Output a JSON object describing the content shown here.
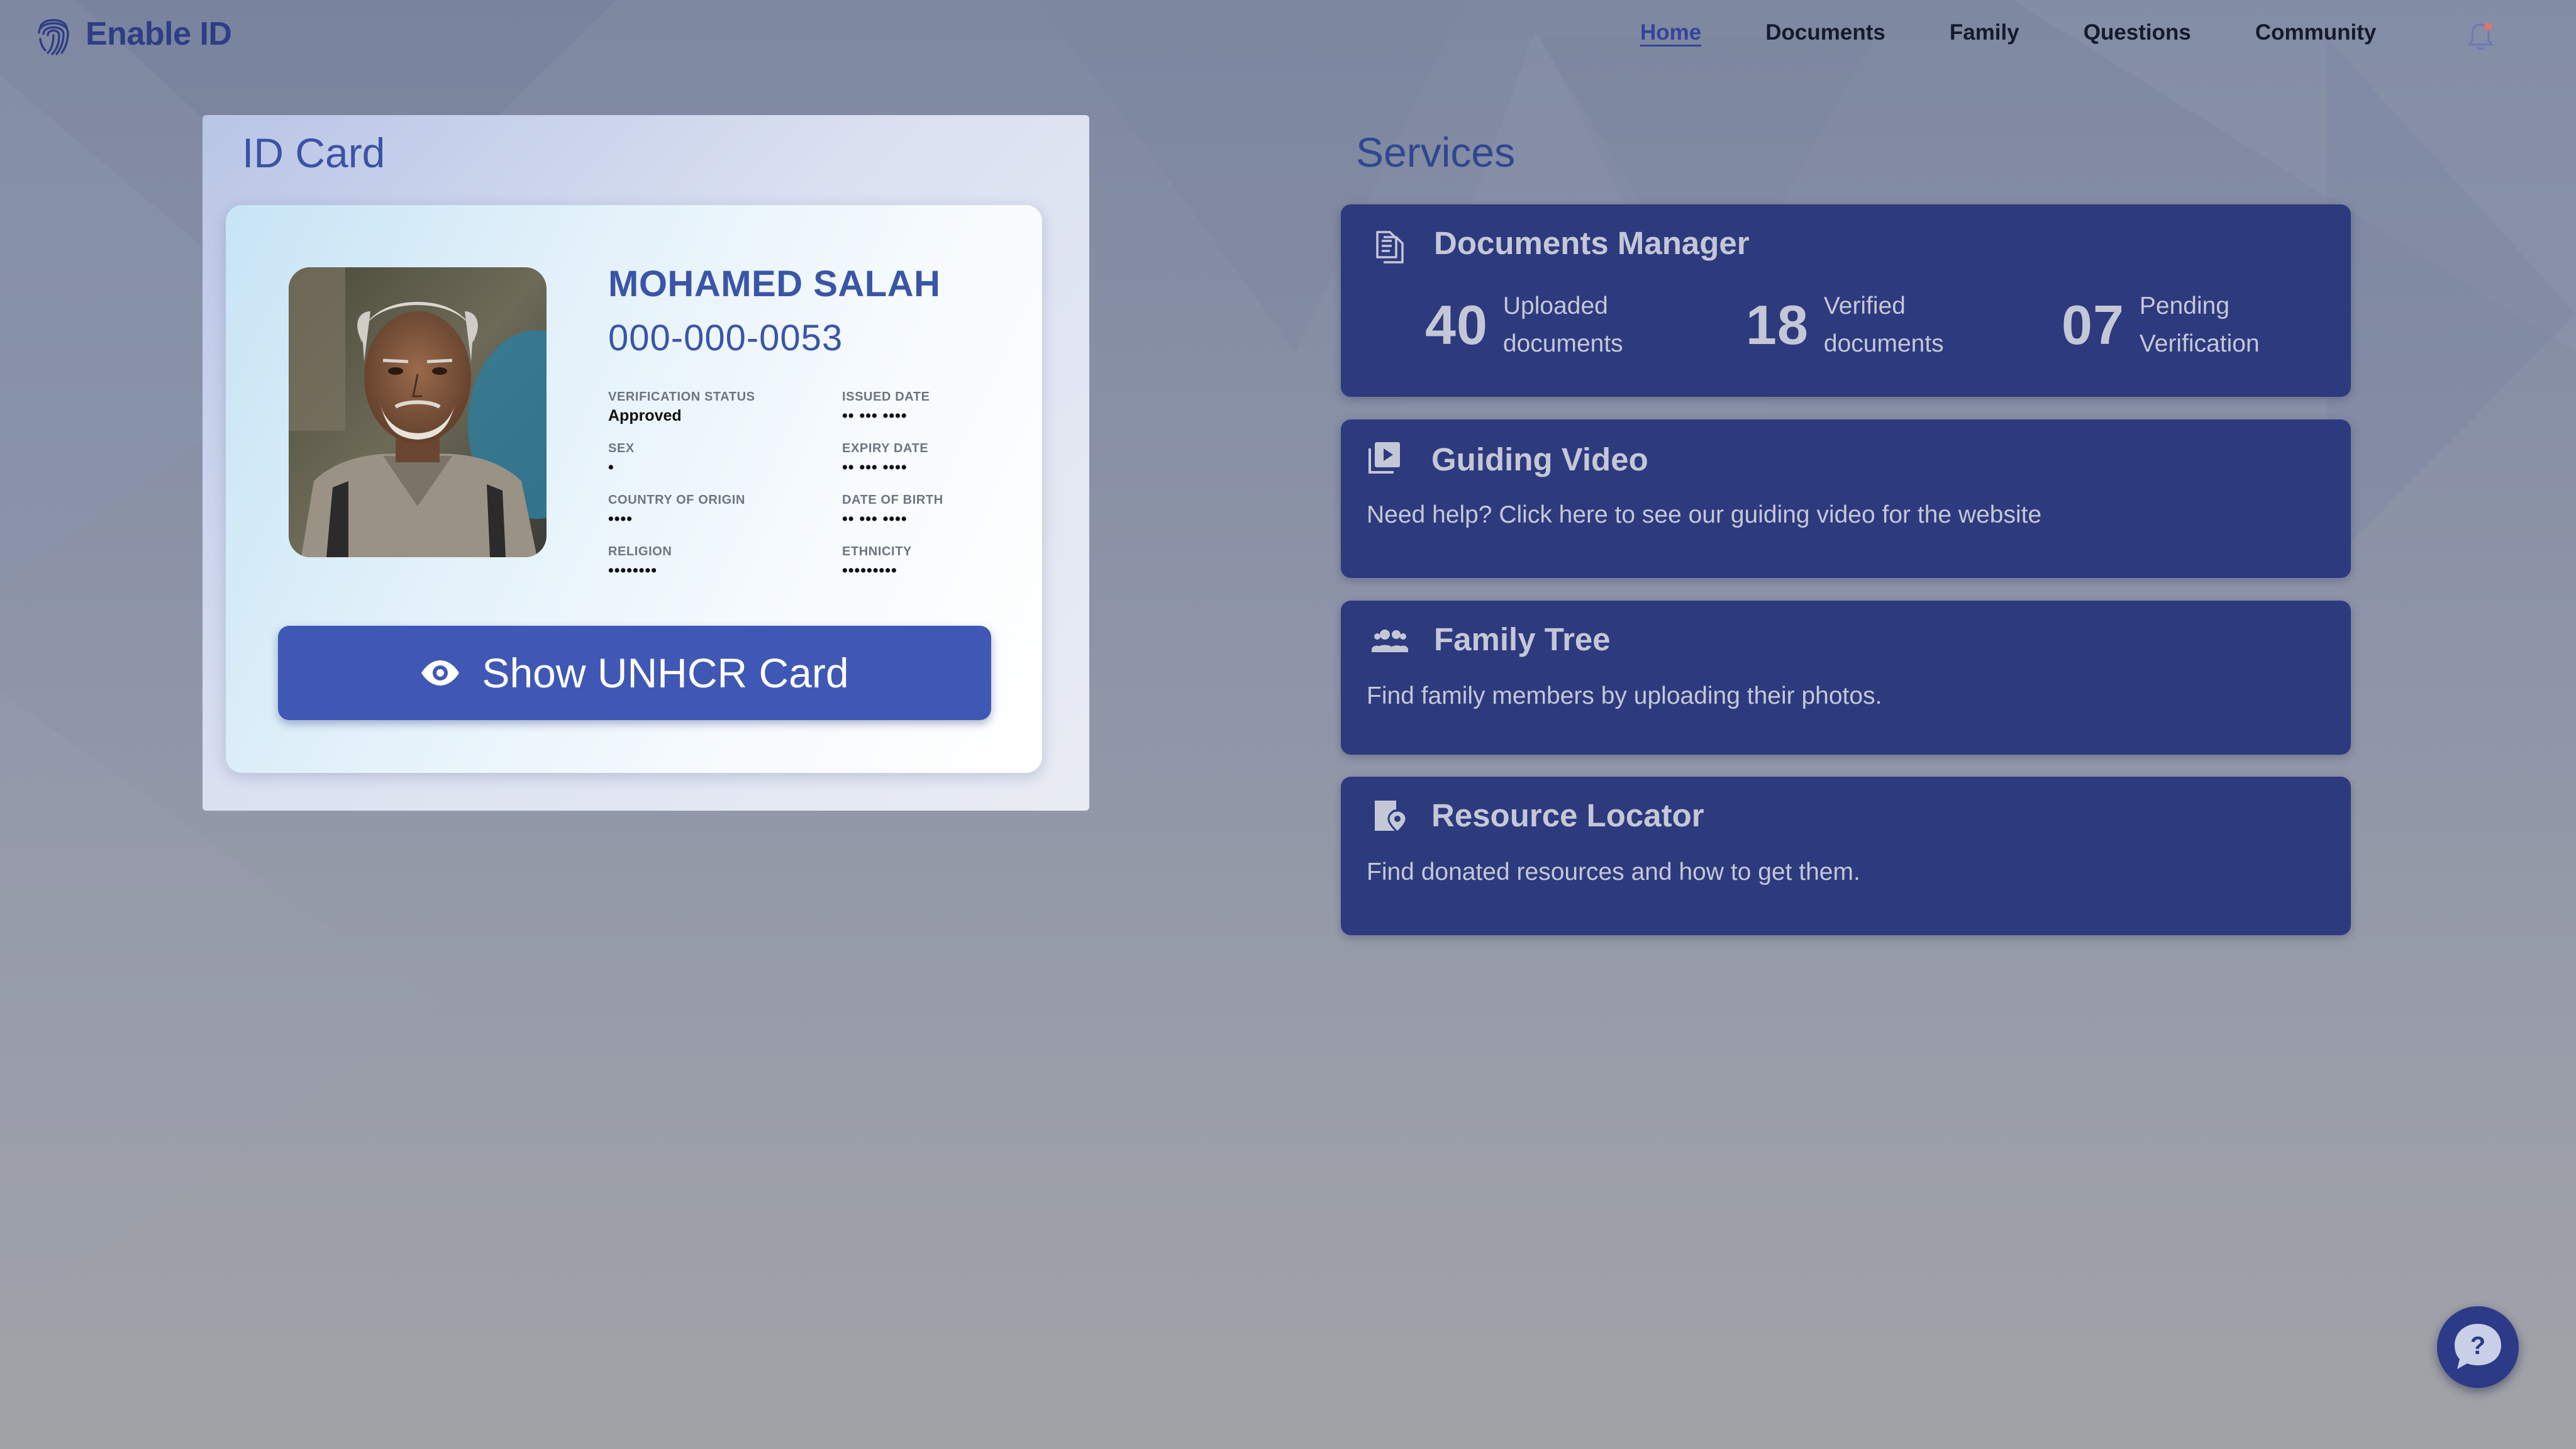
{
  "app": {
    "name": "Enable ID"
  },
  "nav": {
    "links": [
      {
        "label": "Home",
        "active": true
      },
      {
        "label": "Documents"
      },
      {
        "label": "Family"
      },
      {
        "label": "Questions"
      },
      {
        "label": "Community"
      }
    ]
  },
  "id_panel": {
    "title": "ID Card",
    "holder": {
      "name": "MOHAMED SALAH",
      "id_number": "000-000-0053"
    },
    "fields": [
      {
        "label": "VERIFICATION STATUS",
        "value": "Approved"
      },
      {
        "label": "ISSUED DATE",
        "value": "•• ••• ••••"
      },
      {
        "label": "SEX",
        "value": "•"
      },
      {
        "label": "EXPIRY DATE",
        "value": "•• ••• ••••"
      },
      {
        "label": "COUNTRY OF ORIGIN",
        "value": "••••"
      },
      {
        "label": "DATE OF BIRTH",
        "value": "•• ••• ••••"
      },
      {
        "label": "RELIGION",
        "value": "••••••••"
      },
      {
        "label": "ETHNICITY",
        "value": "•••••••••"
      }
    ],
    "show_button": {
      "label": "Show UNHCR Card",
      "icon": "eye-icon"
    }
  },
  "services": {
    "title": "Services",
    "documents_manager": {
      "title": "Documents Manager",
      "icon": "documents-icon",
      "stats": [
        {
          "value": "40",
          "label_line1": "Uploaded",
          "label_line2": "documents"
        },
        {
          "value": "18",
          "label_line1": "Verified",
          "label_line2": "documents"
        },
        {
          "value": "07",
          "label_line1": "Pending",
          "label_line2": "Verification"
        }
      ]
    },
    "guiding_video": {
      "title": "Guiding Video",
      "icon": "video-library-icon",
      "description": "Need help? Click here to see our guiding video for the website"
    },
    "family_tree": {
      "title": "Family Tree",
      "icon": "people-icon",
      "description": "Find family members by uploading their photos."
    },
    "resource_locator": {
      "title": "Resource Locator",
      "icon": "map-pin-icon",
      "description": "Find donated resources and how to get them."
    }
  },
  "help": {
    "glyph": "?"
  },
  "colors": {
    "brand": "#2e3d86",
    "accent": "#4058b5",
    "service_card": "#2d3a7e",
    "service_text": "#c4c8d6",
    "notification_dot": "#e0736a"
  }
}
